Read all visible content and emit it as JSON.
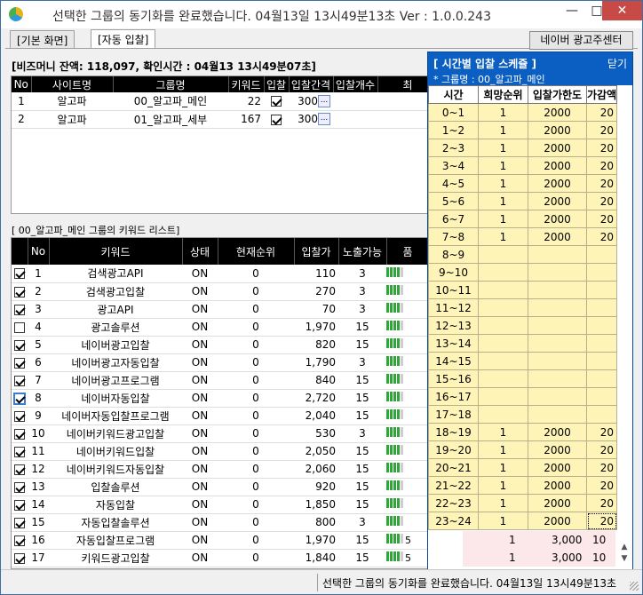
{
  "window": {
    "title": "선택한 그룹의 동기화를 완료했습니다. 04월13일 13시49분13초 Ver : 1.0.0.243",
    "min_glyph": "—",
    "max_glyph": "□",
    "close_glyph": "✕"
  },
  "tabs": [
    {
      "label": "[기본 화면]"
    },
    {
      "label": "[자동 입찰]"
    }
  ],
  "naver_button": "네이버 광고주센터",
  "balance_text": "[비즈머니 잔액: 118,097, 확인시간 : 04월13 13시49분07초]",
  "sites_table": {
    "columns": [
      "No",
      "사이트명",
      "그룹명",
      "키워드",
      "입찰",
      "입찰간격",
      "입찰개수",
      "최"
    ],
    "rows": [
      {
        "no": "1",
        "site": "알고파",
        "group": "00_알고파_메인",
        "keywords": "22",
        "bid": true,
        "interval": "300",
        "btn": "..."
      },
      {
        "no": "2",
        "site": "알고파",
        "group": "01_알고파_세부",
        "keywords": "167",
        "bid": true,
        "interval": "300",
        "btn": "..."
      }
    ]
  },
  "keyword_list_title": "[ 00_알고파_메인 그룹의 키워드 리스트]",
  "keyword_table": {
    "columns": [
      "",
      "No",
      "키워드",
      "상태",
      "현재순위",
      "입찰가",
      "노출가능",
      "품"
    ],
    "rows": [
      {
        "checked": true,
        "no": "1",
        "keyword": "검색광고API",
        "status": "ON",
        "rank": "0",
        "bid": "110",
        "exposure": "3",
        "level": 4
      },
      {
        "checked": true,
        "no": "2",
        "keyword": "검색광고입찰",
        "status": "ON",
        "rank": "0",
        "bid": "270",
        "exposure": "3",
        "level": 4
      },
      {
        "checked": true,
        "no": "3",
        "keyword": "광고API",
        "status": "ON",
        "rank": "0",
        "bid": "70",
        "exposure": "3",
        "level": 4
      },
      {
        "checked": false,
        "no": "4",
        "keyword": "광고솔루션",
        "status": "ON",
        "rank": "0",
        "bid": "1,970",
        "exposure": "15",
        "level": 4
      },
      {
        "checked": true,
        "no": "5",
        "keyword": "네이버광고입찰",
        "status": "ON",
        "rank": "0",
        "bid": "820",
        "exposure": "15",
        "level": 4
      },
      {
        "checked": true,
        "no": "6",
        "keyword": "네이버광고자동입찰",
        "status": "ON",
        "rank": "0",
        "bid": "1,790",
        "exposure": "3",
        "level": 4
      },
      {
        "checked": true,
        "no": "7",
        "keyword": "네이버광고프로그램",
        "status": "ON",
        "rank": "0",
        "bid": "840",
        "exposure": "15",
        "level": 4
      },
      {
        "checked": true,
        "no": "8",
        "keyword": "네이버자동입찰",
        "status": "ON",
        "rank": "0",
        "bid": "2,720",
        "exposure": "15",
        "level": 4
      },
      {
        "checked": true,
        "no": "9",
        "keyword": "네이버자동입찰프로그램",
        "status": "ON",
        "rank": "0",
        "bid": "2,040",
        "exposure": "15",
        "level": 4
      },
      {
        "checked": true,
        "no": "10",
        "keyword": "네이버키워드광고입찰",
        "status": "ON",
        "rank": "0",
        "bid": "530",
        "exposure": "3",
        "level": 4
      },
      {
        "checked": true,
        "no": "11",
        "keyword": "네이버키워드입찰",
        "status": "ON",
        "rank": "0",
        "bid": "2,050",
        "exposure": "15",
        "level": 4
      },
      {
        "checked": true,
        "no": "12",
        "keyword": "네이버키워드자동입찰",
        "status": "ON",
        "rank": "0",
        "bid": "2,060",
        "exposure": "15",
        "level": 4
      },
      {
        "checked": true,
        "no": "13",
        "keyword": "입찰솔루션",
        "status": "ON",
        "rank": "0",
        "bid": "920",
        "exposure": "15",
        "level": 4
      },
      {
        "checked": true,
        "no": "14",
        "keyword": "자동입찰",
        "status": "ON",
        "rank": "0",
        "bid": "1,850",
        "exposure": "15",
        "level": 4
      },
      {
        "checked": true,
        "no": "15",
        "keyword": "자동입찰솔루션",
        "status": "ON",
        "rank": "0",
        "bid": "800",
        "exposure": "3",
        "level": 4
      },
      {
        "checked": true,
        "no": "16",
        "keyword": "자동입찰프로그램",
        "status": "ON",
        "rank": "0",
        "bid": "1,970",
        "exposure": "15",
        "level": 4,
        "quality": "5",
        "extra_rank": "1",
        "extra_limit": "3,000",
        "extra_step": "10"
      },
      {
        "checked": true,
        "no": "17",
        "keyword": "키워드광고입찰",
        "status": "ON",
        "rank": "0",
        "bid": "1,840",
        "exposure": "15",
        "level": 4,
        "quality": "5",
        "extra_rank": "1",
        "extra_limit": "3,000",
        "extra_step": "10"
      }
    ]
  },
  "schedule": {
    "title": "[ 시간별 입찰 스케쥴 ]",
    "close_label": "닫기",
    "group_label": "* 그룹명 : 00_알고파_메인",
    "columns": [
      "시간",
      "희망순위",
      "입찰가한도",
      "가감액"
    ],
    "rows": [
      {
        "time": "0~1",
        "rank": "1",
        "limit": "2000",
        "step": "20"
      },
      {
        "time": "1~2",
        "rank": "1",
        "limit": "2000",
        "step": "20"
      },
      {
        "time": "2~3",
        "rank": "1",
        "limit": "2000",
        "step": "20"
      },
      {
        "time": "3~4",
        "rank": "1",
        "limit": "2000",
        "step": "20"
      },
      {
        "time": "4~5",
        "rank": "1",
        "limit": "2000",
        "step": "20"
      },
      {
        "time": "5~6",
        "rank": "1",
        "limit": "2000",
        "step": "20"
      },
      {
        "time": "6~7",
        "rank": "1",
        "limit": "2000",
        "step": "20"
      },
      {
        "time": "7~8",
        "rank": "1",
        "limit": "2000",
        "step": "20"
      },
      {
        "time": "8~9",
        "rank": "",
        "limit": "",
        "step": ""
      },
      {
        "time": "9~10",
        "rank": "",
        "limit": "",
        "step": ""
      },
      {
        "time": "10~11",
        "rank": "",
        "limit": "",
        "step": ""
      },
      {
        "time": "11~12",
        "rank": "",
        "limit": "",
        "step": ""
      },
      {
        "time": "12~13",
        "rank": "",
        "limit": "",
        "step": ""
      },
      {
        "time": "13~14",
        "rank": "",
        "limit": "",
        "step": ""
      },
      {
        "time": "14~15",
        "rank": "",
        "limit": "",
        "step": ""
      },
      {
        "time": "15~16",
        "rank": "",
        "limit": "",
        "step": ""
      },
      {
        "time": "16~17",
        "rank": "",
        "limit": "",
        "step": ""
      },
      {
        "time": "17~18",
        "rank": "",
        "limit": "",
        "step": ""
      },
      {
        "time": "18~19",
        "rank": "1",
        "limit": "2000",
        "step": "20"
      },
      {
        "time": "19~20",
        "rank": "1",
        "limit": "2000",
        "step": "20"
      },
      {
        "time": "20~21",
        "rank": "1",
        "limit": "2000",
        "step": "20"
      },
      {
        "time": "21~22",
        "rank": "1",
        "limit": "2000",
        "step": "20"
      },
      {
        "time": "22~23",
        "rank": "1",
        "limit": "2000",
        "step": "20"
      },
      {
        "time": "23~24",
        "rank": "1",
        "limit": "2000",
        "step": "20"
      }
    ]
  },
  "scroll": {
    "up": "▲",
    "down": "▼"
  },
  "status_text": "선택한 그룹의 동기화를 완료했습니다. 04월13일 13시49분13초",
  "colors": {
    "accent": "#0b5fc2",
    "schedule_cell": "#fff4b8",
    "level_on": "#2fa53a"
  }
}
